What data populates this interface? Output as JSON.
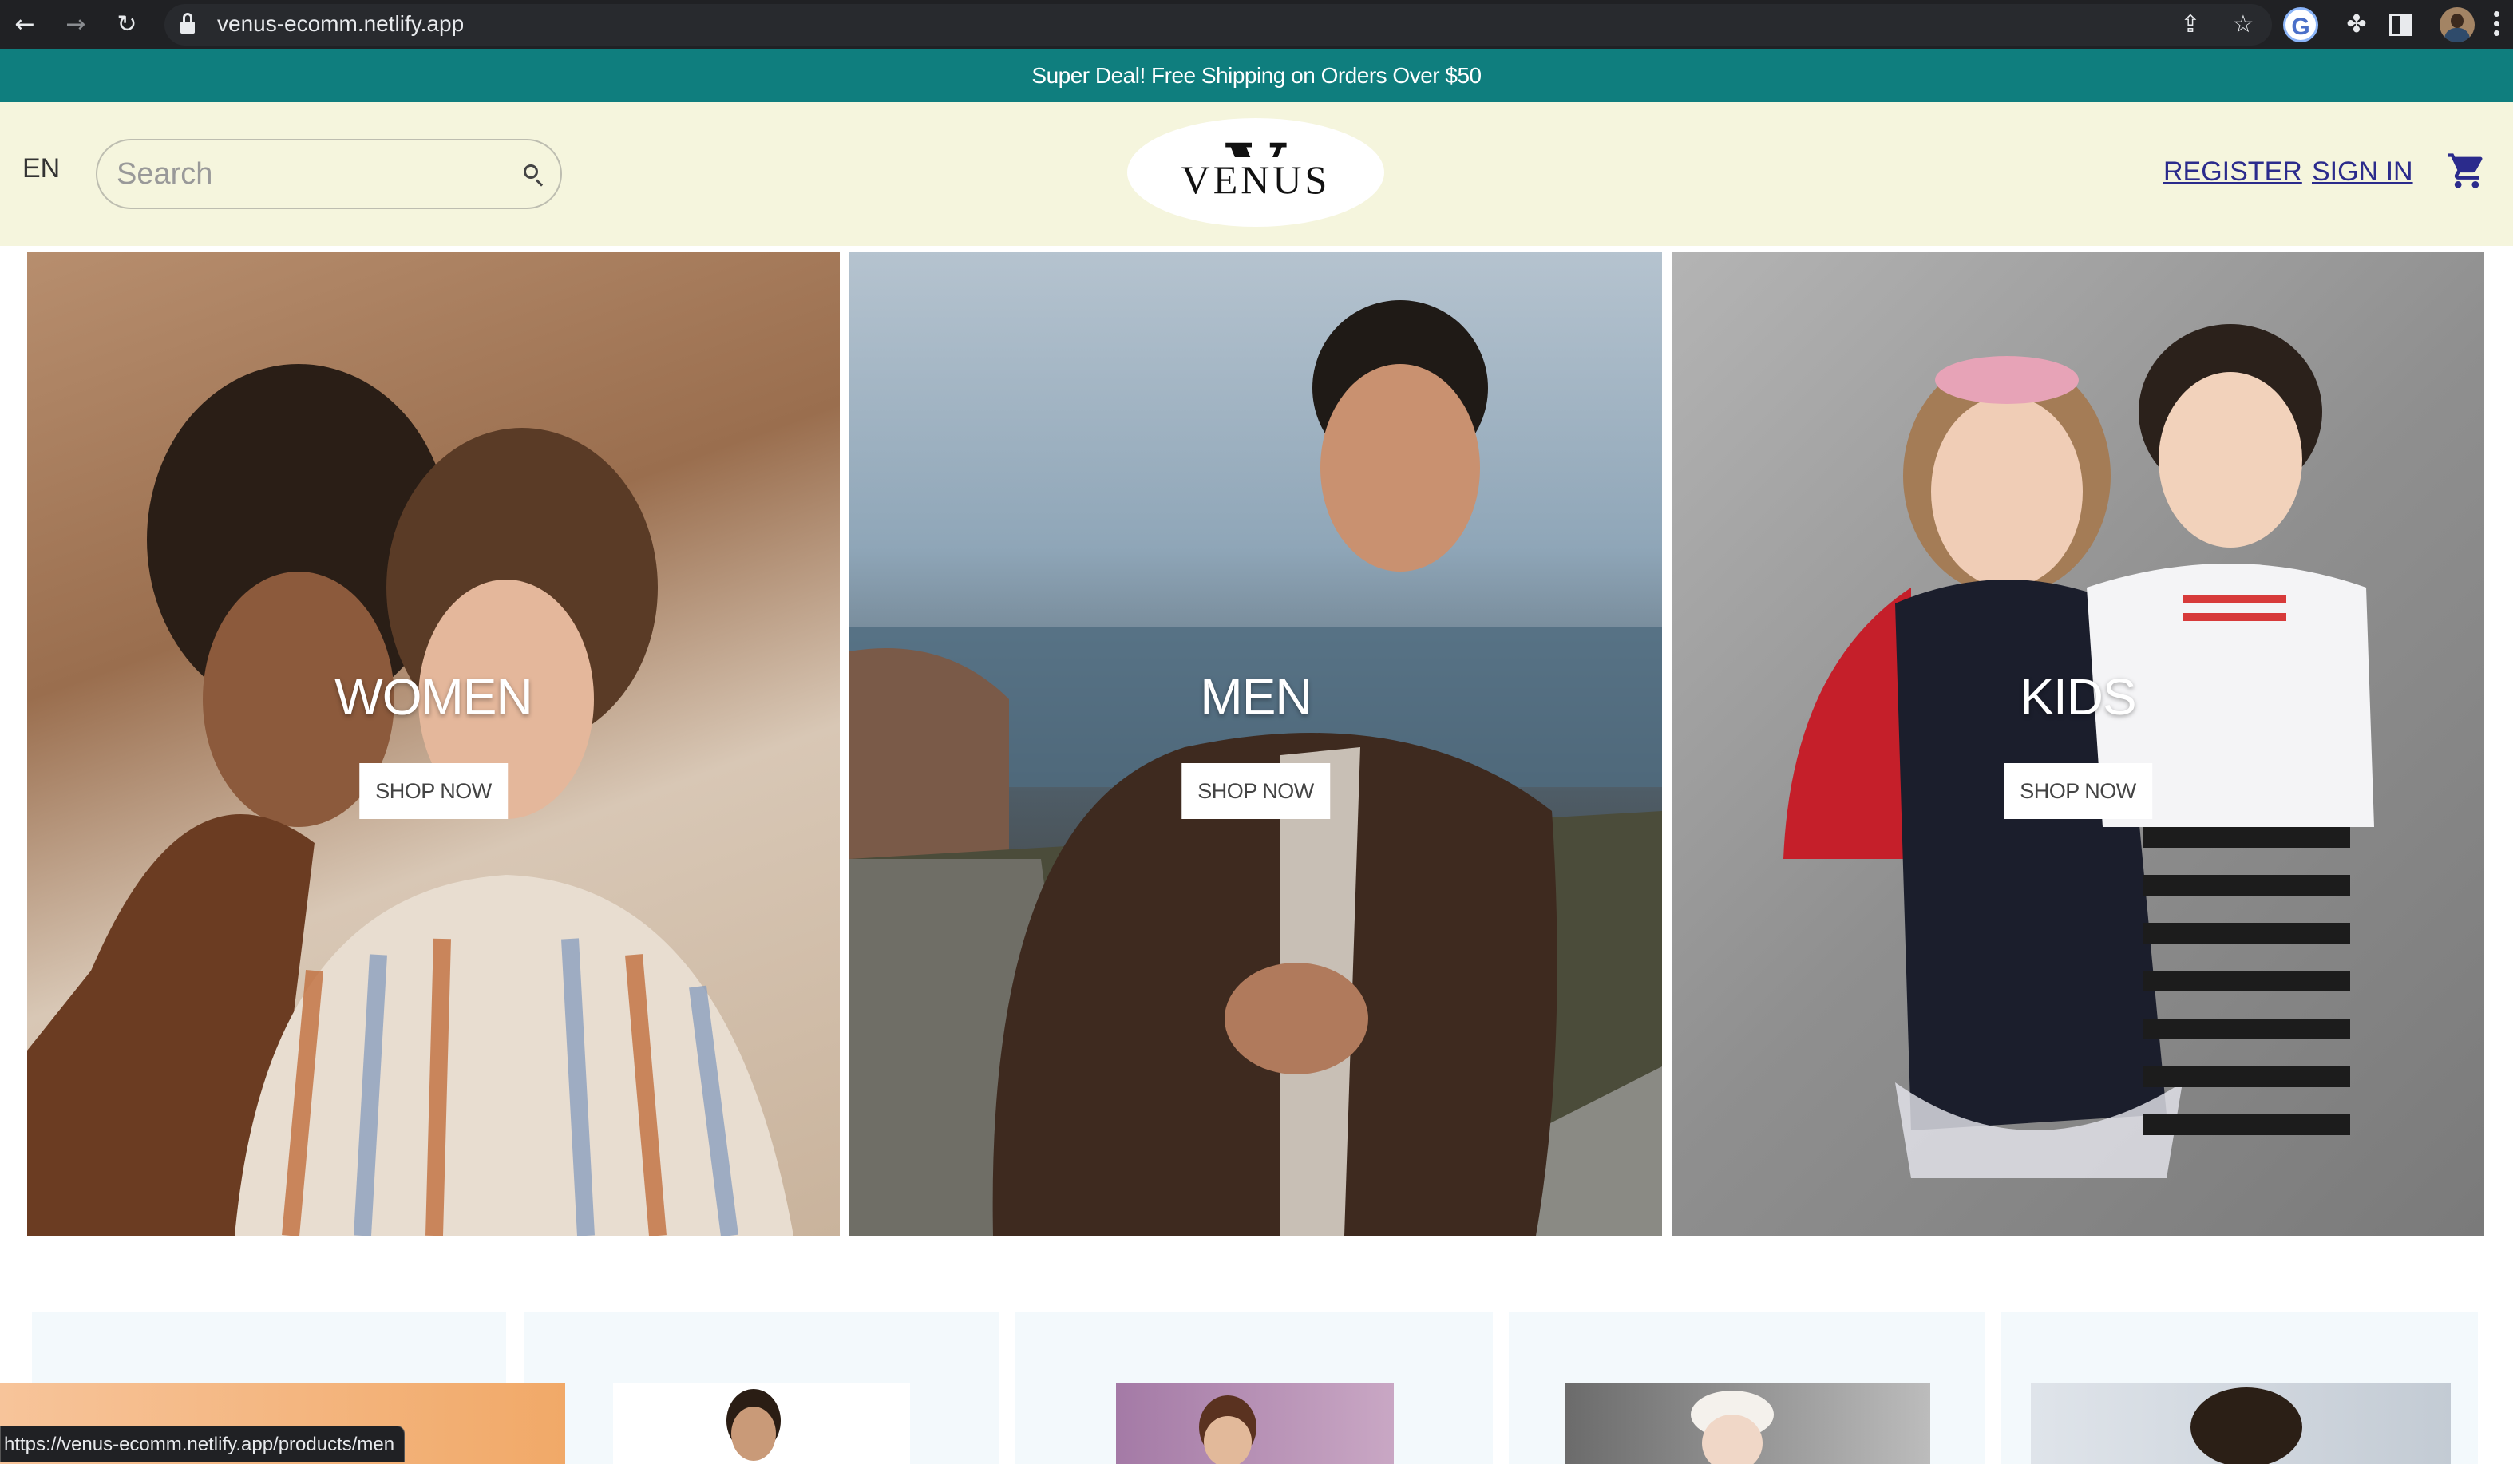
{
  "browser": {
    "url": "venus-ecomm.netlify.app",
    "status_url": "https://venus-ecomm.netlify.app/products/men"
  },
  "promo": {
    "text": "Super Deal! Free Shipping on Orders Over $50",
    "color": "#0f7e7e"
  },
  "header": {
    "language": "EN",
    "search_placeholder": "Search",
    "logo_letter": "V",
    "logo_text": "VENUS",
    "register": "REGISTER",
    "sign_in": "SIGN IN",
    "background": "#f5f5dd",
    "link_color": "#2b2b8c"
  },
  "categories": [
    {
      "title": "WOMEN",
      "button": "SHOP NOW"
    },
    {
      "title": "MEN",
      "button": "SHOP NOW"
    },
    {
      "title": "KIDS",
      "button": "SHOP NOW"
    }
  ]
}
